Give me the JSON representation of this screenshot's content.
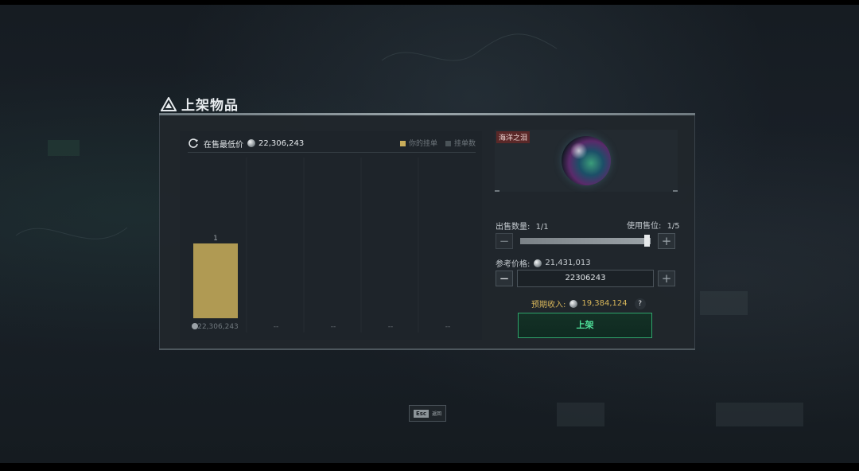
{
  "dialog": {
    "title": "上架物品"
  },
  "chart_header": {
    "lowest_price_label": "在售最低价",
    "lowest_price_value": "22,306,243",
    "legend_mine": "你的挂单",
    "legend_count": "挂单数"
  },
  "chart_data": {
    "type": "bar",
    "categories": [
      "22,306,243",
      "--",
      "--",
      "--",
      "--"
    ],
    "values": [
      1,
      0,
      0,
      0,
      0
    ],
    "series": [
      {
        "name": "你的挂单",
        "values": [
          1,
          0,
          0,
          0,
          0
        ]
      }
    ],
    "data_labels": [
      "1",
      "",
      "",
      "",
      ""
    ]
  },
  "item": {
    "tag": "海洋之泪"
  },
  "sell": {
    "quantity_label": "出售数量:",
    "quantity_value": "1/1",
    "slots_label": "使用售位:",
    "slots_value": "1/5",
    "quantity_fraction": 1.0,
    "minus": "−",
    "plus": "+"
  },
  "price": {
    "ref_label": "参考价格:",
    "ref_value": "21,431,013",
    "input_value": "22306243"
  },
  "income": {
    "label": "预期收入:",
    "value": "19,384,124",
    "help": "?"
  },
  "list_button": "上架",
  "esc": {
    "key": "Esc",
    "label": "返回"
  },
  "colors": {
    "bar": "#b09a53",
    "accent_green": "#2fa36b",
    "gold_text": "#d6b55a"
  }
}
